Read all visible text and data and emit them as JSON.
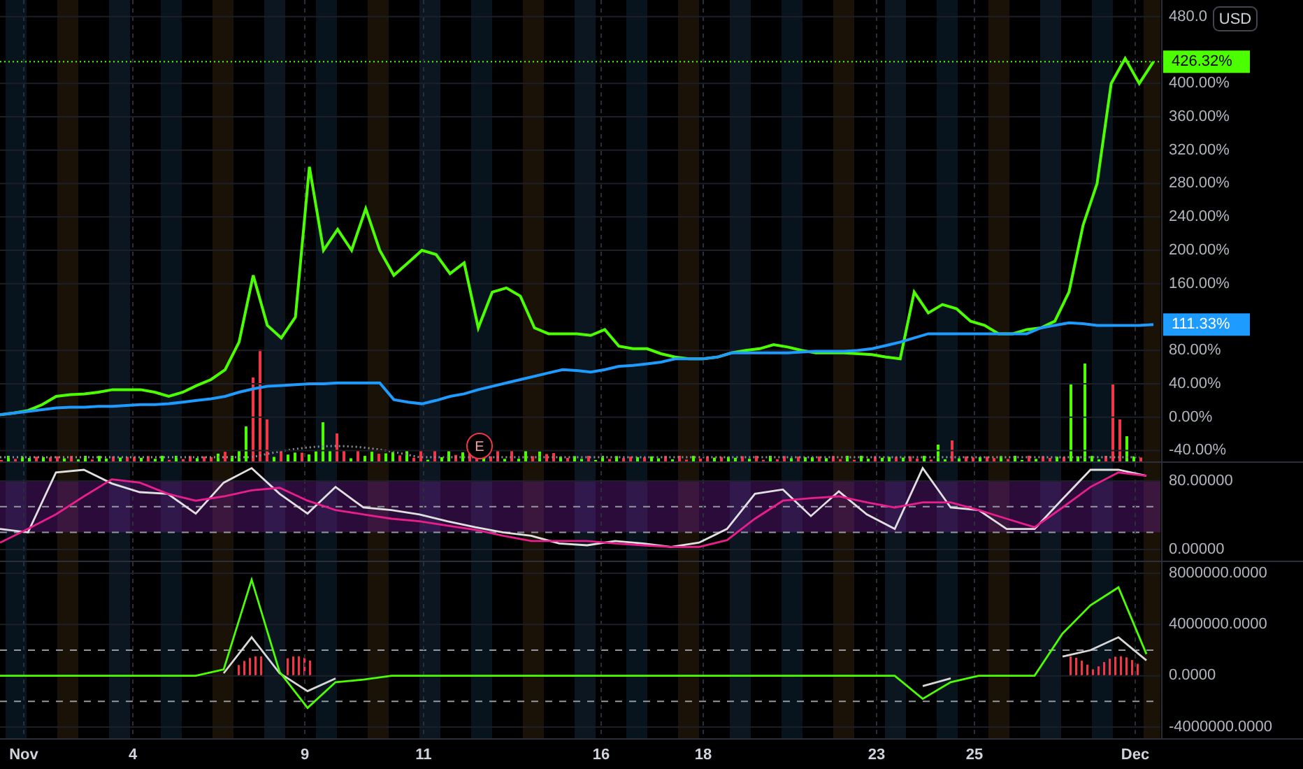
{
  "currency_badge": "USD",
  "main": {
    "price_labels": [
      "426.32%",
      "111.33%"
    ],
    "events": [
      {
        "label": "E"
      }
    ],
    "chart_data": {
      "type": "line",
      "ylim": [
        -53,
        500
      ],
      "grid": true,
      "categories": [
        null,
        null,
        null,
        null,
        null,
        null,
        null,
        null,
        null,
        null,
        null,
        null,
        null,
        null,
        null,
        null,
        null,
        null,
        null,
        null,
        null,
        null,
        null,
        null,
        null,
        null,
        null,
        null,
        null,
        null,
        null,
        null,
        null,
        null,
        null,
        null,
        null,
        null,
        null,
        null,
        null,
        null,
        null,
        null,
        null,
        null,
        null,
        null,
        null,
        null,
        null,
        null,
        null,
        null,
        null,
        null,
        null,
        null,
        null,
        null,
        null,
        null,
        null,
        null,
        null,
        null,
        null,
        null,
        null,
        null,
        null,
        null,
        null,
        null,
        null,
        null,
        null,
        null,
        null,
        null,
        null,
        null,
        null
      ],
      "yticks": [
        {
          "value": 480,
          "label": "480.0"
        },
        {
          "value": 400,
          "label": "400.00%"
        },
        {
          "value": 360,
          "label": "360.00%"
        },
        {
          "value": 320,
          "label": "320.00%"
        },
        {
          "value": 280,
          "label": "280.00%"
        },
        {
          "value": 240,
          "label": "240.00%"
        },
        {
          "value": 200,
          "label": "200.00%"
        },
        {
          "value": 160,
          "label": "160.00%"
        },
        {
          "value": 80,
          "label": "80.00%"
        },
        {
          "value": 40,
          "label": "40.00%"
        },
        {
          "value": 0,
          "label": "0.00%"
        },
        {
          "value": -40,
          "label": "-40.00%"
        }
      ],
      "series": [
        {
          "color": "#4cff00",
          "values": [
            3,
            5,
            8,
            15,
            25,
            27,
            28,
            30,
            33,
            33,
            33,
            30,
            25,
            30,
            38,
            45,
            57,
            90,
            170,
            110,
            95,
            120,
            300,
            200,
            225,
            200,
            250,
            200,
            170,
            185,
            200,
            195,
            172,
            185,
            107,
            150,
            155,
            145,
            107,
            100,
            100,
            100,
            98,
            105,
            85,
            82,
            82,
            76,
            72,
            70,
            70,
            72,
            77,
            80,
            82,
            87,
            84,
            80,
            77,
            77,
            77,
            76,
            75,
            72,
            70,
            150,
            125,
            135,
            130,
            115,
            110,
            100,
            100,
            105,
            107,
            115,
            150,
            230,
            280,
            400,
            430,
            400,
            426
          ]
        },
        {
          "color": "#1e9bff",
          "values": [
            3,
            5,
            7,
            9,
            11,
            12,
            12,
            13,
            13,
            14,
            15,
            15,
            16,
            18,
            20,
            22,
            25,
            30,
            34,
            37,
            38,
            39,
            40,
            40,
            41,
            41,
            41,
            41,
            21,
            18,
            16,
            20,
            25,
            28,
            33,
            37,
            41,
            45,
            49,
            53,
            57,
            56,
            54,
            57,
            61,
            62,
            64,
            66,
            70,
            70,
            70,
            72,
            77,
            77,
            77,
            77,
            77,
            78,
            79,
            79,
            79,
            80,
            82,
            86,
            90,
            95,
            100,
            100,
            100,
            100,
            100,
            100,
            100,
            100,
            107,
            110,
            113,
            112,
            110,
            110,
            110,
            110,
            111
          ]
        }
      ]
    }
  },
  "oscillator": {
    "chart_data": {
      "type": "line",
      "ylim": [
        -13,
        101.2
      ],
      "grid": true,
      "categories": [
        null,
        null,
        null,
        null,
        null,
        null,
        null,
        null,
        null,
        null,
        null,
        null,
        null,
        null,
        null,
        null,
        null,
        null,
        null,
        null,
        null,
        null,
        null,
        null,
        null,
        null,
        null,
        null,
        null,
        null,
        null,
        null,
        null,
        null,
        null,
        null,
        null,
        null,
        null,
        null,
        null,
        null
      ],
      "yticks": [
        {
          "value": 80,
          "label": "80.00000"
        },
        {
          "value": 0,
          "label": "0.00000"
        }
      ],
      "series": [
        {
          "color": "#e0e0e0",
          "values": [
            24,
            20,
            90,
            93,
            77,
            67,
            65,
            42,
            78,
            95,
            65,
            42,
            73,
            49,
            46,
            41,
            33,
            26,
            20,
            16,
            7,
            5,
            10,
            7,
            3,
            8,
            24,
            65,
            70,
            39,
            68,
            41,
            24,
            95,
            49,
            46,
            24,
            24,
            59,
            93,
            93,
            86
          ]
        },
        {
          "color": "#e91e8c",
          "values": [
            8,
            24,
            41,
            62,
            82,
            78,
            65,
            57,
            62,
            69,
            72,
            57,
            46,
            41,
            36,
            33,
            28,
            23,
            16,
            10,
            10,
            10,
            7,
            5,
            3,
            3,
            11,
            36,
            57,
            60,
            62,
            55,
            49,
            55,
            55,
            46,
            36,
            26,
            49,
            73,
            90,
            86
          ]
        }
      ]
    }
  },
  "flow": {
    "chart_data": {
      "type": "line",
      "ylim": [
        -4872000,
        8872000
      ],
      "grid": true,
      "categories": [
        null,
        null,
        null,
        null,
        null,
        null,
        null,
        null,
        null,
        null,
        null,
        null,
        null,
        null,
        null,
        null,
        null,
        null,
        null,
        null,
        null,
        null,
        null,
        null,
        null,
        null,
        null,
        null,
        null,
        null,
        null,
        null,
        null,
        null,
        null,
        null,
        null,
        null,
        null,
        null,
        null,
        null
      ],
      "yticks": [
        {
          "value": 8000000,
          "label": "8000000.0000"
        },
        {
          "value": 4000000,
          "label": "4000000.0000"
        },
        {
          "value": 0,
          "label": "0.0000"
        },
        {
          "value": -4000000,
          "label": "-4000000.0000"
        }
      ],
      "series": [
        {
          "color": "#d8d8d8",
          "values": [
            null,
            null,
            null,
            null,
            null,
            null,
            null,
            null,
            200000,
            3000000,
            200000,
            -1200000,
            -200000,
            null,
            null,
            null,
            null,
            null,
            null,
            null,
            null,
            null,
            null,
            null,
            null,
            null,
            null,
            null,
            null,
            null,
            null,
            null,
            null,
            -800000,
            -200000,
            null,
            null,
            null,
            1500000,
            2000000,
            3000000,
            1200000
          ]
        },
        {
          "color": "#4cff00",
          "values": [
            0,
            0,
            0,
            0,
            0,
            0,
            0,
            0,
            500000,
            7500000,
            300000,
            -2500000,
            -500000,
            -300000,
            0,
            0,
            0,
            0,
            0,
            0,
            0,
            0,
            0,
            0,
            0,
            0,
            0,
            0,
            0,
            0,
            0,
            0,
            0,
            -1800000,
            -500000,
            0,
            0,
            0,
            3300000,
            5500000,
            6900000,
            1700000
          ]
        }
      ]
    }
  },
  "time_axis": [
    "Nov",
    "4",
    "9",
    "11",
    "16",
    "18",
    "23",
    "25",
    "Dec"
  ]
}
